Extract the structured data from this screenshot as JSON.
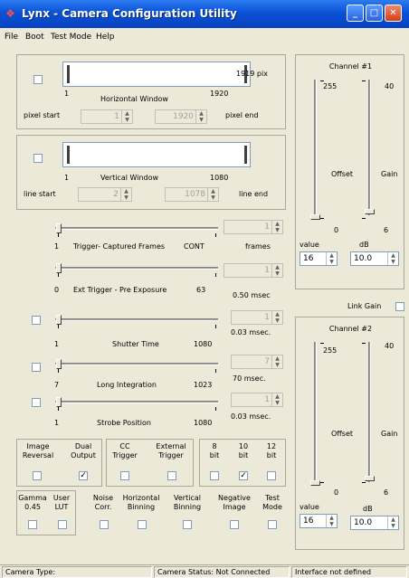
{
  "window": {
    "title": "Lynx - Camera Configuration Utility",
    "app_icon": "lynx-icon"
  },
  "menu": [
    "File",
    "Boot",
    "Test Mode",
    "Help"
  ],
  "horizontal": {
    "label": "Horizontal Window",
    "min": "1",
    "max": "1920",
    "readout": "1919 pix",
    "pixel_start_label": "pixel start",
    "pixel_start": "1",
    "pixel_end_value": "1920",
    "pixel_end_label": "pixel end"
  },
  "vertical": {
    "label": "Vertical Window",
    "min": "1",
    "max": "1080",
    "line_start_label": "line start",
    "line_start": "2",
    "line_end_value": "1078",
    "line_end_label": "line end"
  },
  "trigger": {
    "label": "Trigger- Captured Frames",
    "min": "1",
    "max": "CONT",
    "spin": "1",
    "unit": "frames"
  },
  "ext_trigger": {
    "label": "Ext Trigger - Pre Exposure",
    "min": "0",
    "max": "63",
    "spin": "1",
    "readout": "0.50 msec"
  },
  "shutter": {
    "label": "Shutter Time",
    "min": "1",
    "max": "1080",
    "spin": "1",
    "readout": "0.03 msec."
  },
  "long_integration": {
    "label": "Long Integration",
    "min": "7",
    "max": "1023",
    "spin": "7",
    "readout": "70 msec."
  },
  "strobe": {
    "label": "Strobe Position",
    "min": "1",
    "max": "1080",
    "spin": "1",
    "readout": "0.03 msec."
  },
  "channel1": {
    "title": "Channel #1",
    "offset_max": "255",
    "offset_min": "0",
    "offset_label": "Offset",
    "gain_max": "40",
    "gain_min": "6",
    "gain_label": "Gain",
    "value_label": "value",
    "db_label": "dB",
    "value": "16",
    "db": "10.0"
  },
  "link_gain": "Link  Gain",
  "channel2": {
    "title": "Channel #2",
    "offset_max": "255",
    "offset_min": "0",
    "offset_label": "Offset",
    "gain_max": "40",
    "gain_min": "6",
    "gain_label": "Gain",
    "value_label": "value",
    "db_label": "dB",
    "value": "16",
    "db": "10.0"
  },
  "options_row1": {
    "image_reversal": [
      "Image",
      "Reversal"
    ],
    "dual_output": [
      "Dual",
      "Output"
    ],
    "cc_trigger": [
      "CC",
      "Trigger"
    ],
    "external_trigger": [
      "External",
      "Trigger"
    ],
    "bit8": [
      "8",
      "bit"
    ],
    "bit10": [
      "10",
      "bit"
    ],
    "bit12": [
      "12",
      "bit"
    ]
  },
  "options_row2": {
    "gamma": [
      "Gamma",
      "0.45"
    ],
    "user_lut": [
      "User",
      "LUT"
    ],
    "noise_corr": [
      "Noise",
      "Corr."
    ],
    "h_binning": [
      "Horizontal",
      "Binning"
    ],
    "v_binning": [
      "Vertical",
      "Binning"
    ],
    "negative": [
      "Negative",
      "Image"
    ],
    "test_mode": [
      "Test",
      "Mode"
    ]
  },
  "status": {
    "camera_type": "Camera Type:",
    "camera_status": "Camera Status: Not Connected",
    "interface": "Interface not defined"
  }
}
